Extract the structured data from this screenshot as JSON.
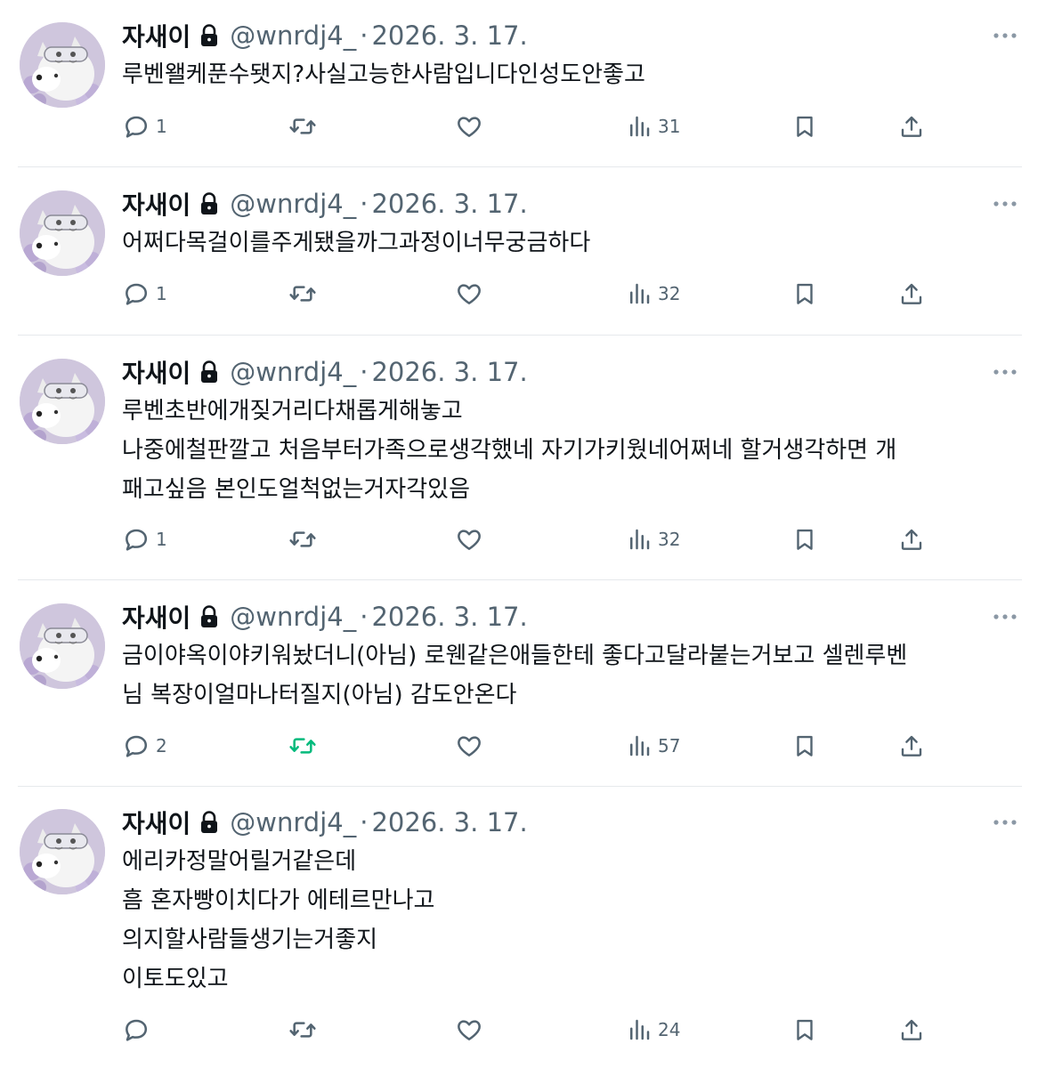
{
  "author": {
    "name": "자새이",
    "handle": "@wnrdj4_",
    "separator": "·",
    "date": "2026. 3. 17."
  },
  "colors": {
    "text": "#0f1419",
    "secondary": "#536471",
    "retweet_active": "#00ba7c",
    "divider": "#e6e9ec"
  },
  "icons": {
    "reply": "speech-bubble",
    "retweet": "repost-arrows",
    "like": "heart-outline",
    "views": "bar-chart",
    "bookmark": "bookmark-outline",
    "share": "upload-arrow",
    "more": "three-dots",
    "protected": "lock"
  },
  "tweets": [
    {
      "lines": [
        "루벤왤케푼수됏지?사실고능한사람입니다인성도안좋고"
      ],
      "replies": "1",
      "retweets": "",
      "likes": "",
      "views": "31",
      "retweeted": false
    },
    {
      "lines": [
        "어쩌다목걸이를주게됐을까그과정이너무궁금하다"
      ],
      "replies": "1",
      "retweets": "",
      "likes": "",
      "views": "32",
      "retweeted": false
    },
    {
      "lines": [
        "루벤초반에개짖거리다채롭게해놓고",
        "나중에철판깔고 처음부터가족으로생각했네 자기가키웠네어쩌네 할거생각하면 개",
        "패고싶음 본인도얼척없는거자각있음"
      ],
      "replies": "1",
      "retweets": "",
      "likes": "",
      "views": "32",
      "retweeted": false
    },
    {
      "lines": [
        "금이야옥이야키워놨더니(아님) 로웬같은애들한테 좋다고달라붙는거보고 셀렌루벤",
        "님 복장이얼마나터질지(아님) 감도안온다"
      ],
      "replies": "2",
      "retweets": "",
      "likes": "",
      "views": "57",
      "retweeted": true
    },
    {
      "lines": [
        "에리카정말어릴거같은데",
        "흠 혼자빵이치다가 에테르만나고",
        "의지할사람들생기는거좋지",
        "이토도있고"
      ],
      "replies": "",
      "retweets": "",
      "likes": "",
      "views": "24",
      "retweeted": false
    }
  ]
}
